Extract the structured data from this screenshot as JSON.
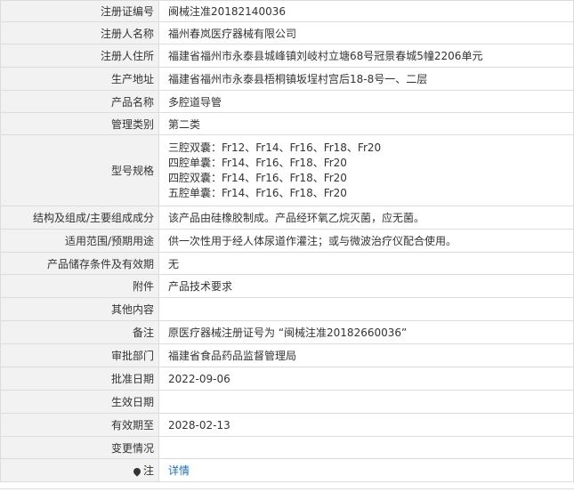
{
  "rows": [
    {
      "label": "注册证编号",
      "value": "闽械注准20182140036"
    },
    {
      "label": "注册人名称",
      "value": "福州春岚医疗器械有限公司"
    },
    {
      "label": "注册人住所",
      "value": "福建省福州市永泰县城峰镇刘岐村立塘68号冠景春城5幢2206单元"
    },
    {
      "label": "生产地址",
      "value": "福建省福州市永泰县梧桐镇坂埕村宫后18-8号一、二层"
    },
    {
      "label": "产品名称",
      "value": "多腔道导管"
    },
    {
      "label": "管理类别",
      "value": "第二类"
    },
    {
      "label": "型号规格",
      "lines": [
        "三腔双囊：Fr12、Fr14、Fr16、Fr18、Fr20",
        "四腔单囊：Fr14、Fr16、Fr18、Fr20",
        "四腔双囊：Fr14、Fr16、Fr18、Fr20",
        "五腔单囊：Fr14、Fr16、Fr18、Fr20"
      ]
    },
    {
      "label": "结构及组成/主要组成成分",
      "value": "该产品由硅橡胶制成。产品经环氧乙烷灭菌，应无菌。"
    },
    {
      "label": "适用范围/预期用途",
      "value": "供一次性用于经人体尿道作灌注；或与微波治疗仪配合使用。"
    },
    {
      "label": "产品储存条件及有效期",
      "value": "无"
    },
    {
      "label": "附件",
      "value": "产品技术要求"
    },
    {
      "label": "其他内容",
      "value": ""
    },
    {
      "label": "备注",
      "value": "原医疗器械注册证号为 “闽械注准20182660036”"
    },
    {
      "label": "审批部门",
      "value": "福建省食品药品监督管理局"
    },
    {
      "label": "批准日期",
      "value": "2022-09-06"
    },
    {
      "label": "生效日期",
      "value": ""
    },
    {
      "label": "有效期至",
      "value": "2028-02-13"
    },
    {
      "label": "变更情况",
      "value": ""
    }
  ],
  "note": {
    "label": "注",
    "icon": "location-pin-icon",
    "link_text": "详情"
  }
}
